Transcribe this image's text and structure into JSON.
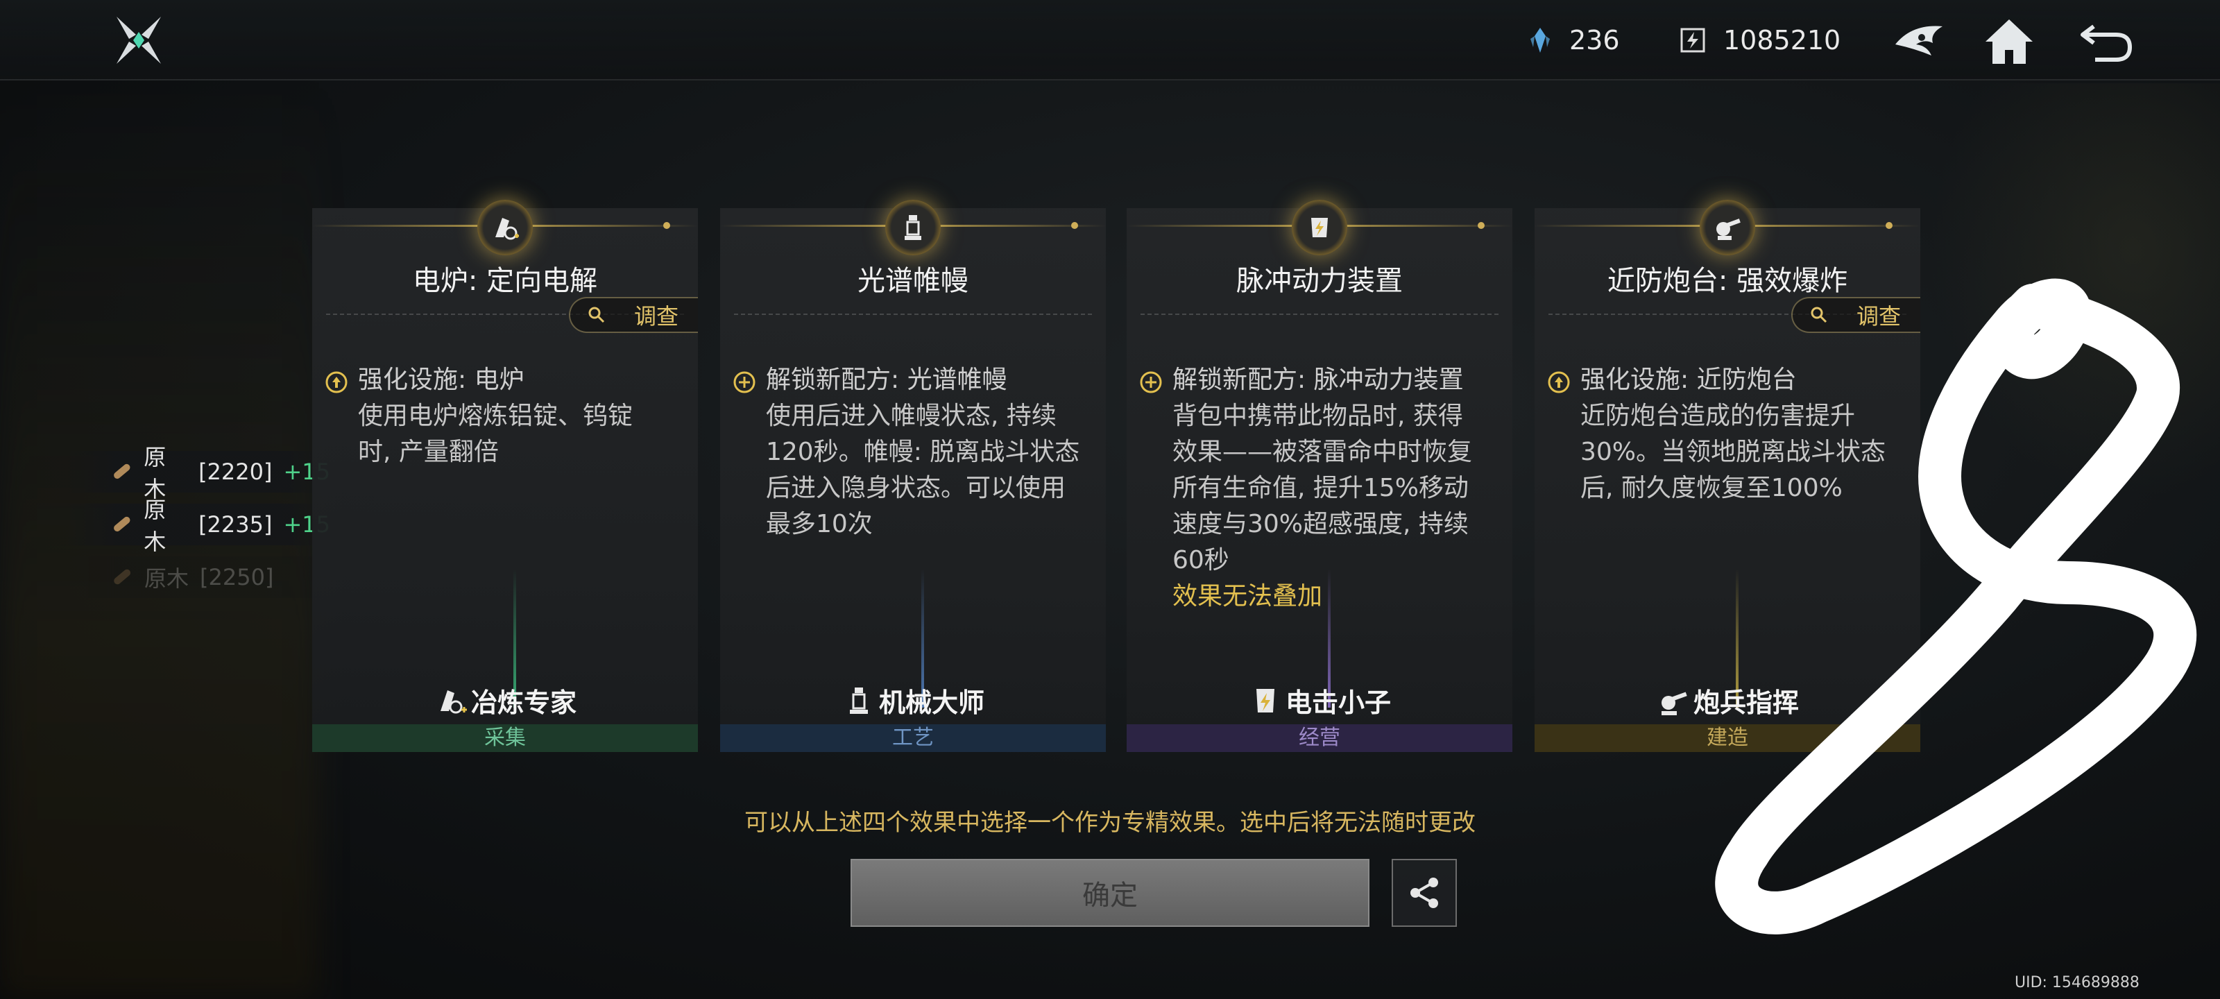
{
  "topbar": {
    "resource_1": {
      "icon": "crystal-icon",
      "value": "236"
    },
    "resource_2": {
      "icon": "chip-currency-icon",
      "value": "1085210"
    }
  },
  "side_items": [
    {
      "name": "原木",
      "level": "[2220]",
      "bonus": "+15"
    },
    {
      "name": "原木",
      "level": "[2235]",
      "bonus": "+15"
    },
    {
      "name": "原木",
      "level": "[2250]",
      "bonus": ""
    }
  ],
  "cards": [
    {
      "title": "电炉: 定向电解",
      "investigate_label": "调查",
      "has_investigate": true,
      "bullet": "upgrade-icon",
      "head": "强化设施: 电炉",
      "body": "使用电炉熔炼铝锭、钨锭\n时, 产量翻倍",
      "warn": "",
      "specialist": "冶炼专家",
      "category": "采集",
      "accent": "#3fcf8a",
      "tag_bg": "#1d3a2a",
      "tag_color": "#6fc49a"
    },
    {
      "title": "光谱帷幔",
      "investigate_label": "",
      "has_investigate": false,
      "bullet": "unlock-icon",
      "head": "解锁新配方: 光谱帷幔",
      "body": "使用后进入帷幔状态, 持续\n120秒。帷幔: 脱离战斗状态\n后进入隐身状态。可以使用\n最多10次",
      "warn": "",
      "specialist": "机械大师",
      "category": "工艺",
      "accent": "#5a8fd8",
      "tag_bg": "#1b2c40",
      "tag_color": "#6f95c4"
    },
    {
      "title": "脉冲动力装置",
      "investigate_label": "",
      "has_investigate": false,
      "bullet": "unlock-icon",
      "head": "解锁新配方: 脉冲动力装置",
      "body": "背包中携带此物品时, 获得\n效果——被落雷命中时恢复\n所有生命值, 提升15%移动\n速度与30%超感强度, 持续\n60秒",
      "warn": "效果无法叠加",
      "specialist": "电击小子",
      "category": "经营",
      "accent": "#9a7ae0",
      "tag_bg": "#2c2444",
      "tag_color": "#9d8ac9"
    },
    {
      "title": "近防炮台: 强效爆炸",
      "investigate_label": "调查",
      "has_investigate": true,
      "bullet": "upgrade-icon",
      "head": "强化设施: 近防炮台",
      "body": "近防炮台造成的伤害提升\n30%。当领地脱离战斗状态\n后, 耐久度恢复至100%",
      "warn": "",
      "specialist": "炮兵指挥",
      "category": "建造",
      "accent": "#d8bf4a",
      "tag_bg": "#3a3216",
      "tag_color": "#c4a85a"
    }
  ],
  "hint": "可以从上述四个效果中选择一个作为专精效果。选中后将无法随时更改",
  "confirm_label": "确定",
  "uid": "UID: 154689888",
  "overlay_glyph": "8"
}
